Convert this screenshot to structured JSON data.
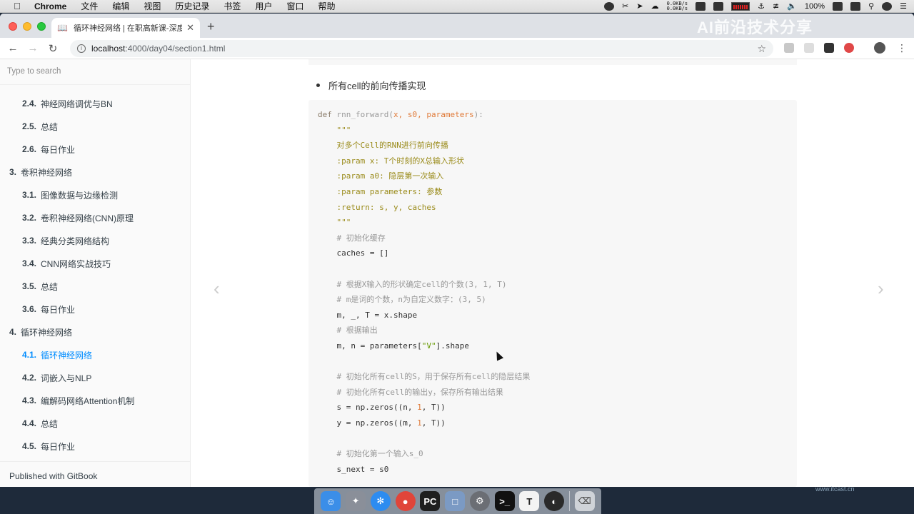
{
  "menubar": {
    "app": "Chrome",
    "items": [
      "文件",
      "编辑",
      "视图",
      "历史记录",
      "书签",
      "用户",
      "窗口",
      "帮助"
    ],
    "netspeed_up": "0.0KB/s",
    "netspeed_down": "0.0KB/s",
    "battery": "100%"
  },
  "browser": {
    "tab_title": "循环神经网络 | 在职高新课-深度",
    "watermark": "AI前沿技术分享",
    "url_host": "localhost",
    "url_path": ":4000/day04/section1.html"
  },
  "sidebar": {
    "search_placeholder": "Type to search",
    "items": [
      {
        "num": "2.4.",
        "label": "神经网络调优与BN",
        "level": 2
      },
      {
        "num": "2.5.",
        "label": "总结",
        "level": 2
      },
      {
        "num": "2.6.",
        "label": "每日作业",
        "level": 2
      },
      {
        "num": "3.",
        "label": "卷积神经网络",
        "level": 1
      },
      {
        "num": "3.1.",
        "label": "图像数据与边缘检测",
        "level": 2
      },
      {
        "num": "3.2.",
        "label": "卷积神经网络(CNN)原理",
        "level": 2
      },
      {
        "num": "3.3.",
        "label": "经典分类网络结构",
        "level": 2
      },
      {
        "num": "3.4.",
        "label": "CNN网络实战技巧",
        "level": 2
      },
      {
        "num": "3.5.",
        "label": "总结",
        "level": 2
      },
      {
        "num": "3.6.",
        "label": "每日作业",
        "level": 2
      },
      {
        "num": "4.",
        "label": "循环神经网络",
        "level": 1
      },
      {
        "num": "4.1.",
        "label": "循环神经网络",
        "level": 2,
        "active": true
      },
      {
        "num": "4.2.",
        "label": "词嵌入与NLP",
        "level": 2
      },
      {
        "num": "4.3.",
        "label": "编解码网络Attention机制",
        "level": 2
      },
      {
        "num": "4.4.",
        "label": "总结",
        "level": 2
      },
      {
        "num": "4.5.",
        "label": "每日作业",
        "level": 2
      }
    ],
    "footer": "Published with GitBook"
  },
  "content": {
    "bullet": "所有cell的前向传播实现",
    "code_lines": [
      [
        [
          "kw",
          "def "
        ],
        [
          "fn",
          "rnn_forward("
        ],
        [
          "pm",
          "x, s0, parameters"
        ],
        [
          "fn",
          "):"
        ]
      ],
      [
        [
          "",
          "    "
        ],
        [
          "ds",
          "\"\"\""
        ]
      ],
      [
        [
          "",
          "    "
        ],
        [
          "ds",
          "对多个Cell的RNN进行前向传播"
        ]
      ],
      [
        [
          "",
          "    "
        ],
        [
          "ds",
          ":param x: T个时刻的X总输入形状"
        ]
      ],
      [
        [
          "",
          "    "
        ],
        [
          "ds",
          ":param a0: 隐层第一次输入"
        ]
      ],
      [
        [
          "",
          "    "
        ],
        [
          "ds",
          ":param parameters: 参数"
        ]
      ],
      [
        [
          "",
          "    "
        ],
        [
          "ds",
          ":return: s, y, caches"
        ]
      ],
      [
        [
          "",
          "    "
        ],
        [
          "ds",
          "\"\"\""
        ]
      ],
      [
        [
          "",
          "    "
        ],
        [
          "cm",
          "# 初始化缓存"
        ]
      ],
      [
        [
          "",
          "    caches = []"
        ]
      ],
      [
        [
          "",
          ""
        ]
      ],
      [
        [
          "",
          "    "
        ],
        [
          "cm",
          "# 根据X输入的形状确定cell的个数(3, 1, T)"
        ]
      ],
      [
        [
          "",
          "    "
        ],
        [
          "cm",
          "# m是词的个数，n为自定义数字：(3, 5)"
        ]
      ],
      [
        [
          "",
          "    m, _, T = x.shape"
        ]
      ],
      [
        [
          "",
          "    "
        ],
        [
          "cm",
          "# 根据输出"
        ]
      ],
      [
        [
          "",
          "    m, n = parameters["
        ],
        [
          "st",
          "\"V\""
        ],
        [
          "",
          "].shape"
        ]
      ],
      [
        [
          "",
          ""
        ]
      ],
      [
        [
          "",
          "    "
        ],
        [
          "cm",
          "# 初始化所有cell的S，用于保存所有cell的隐层结果"
        ]
      ],
      [
        [
          "",
          "    "
        ],
        [
          "cm",
          "# 初始化所有cell的输出y，保存所有输出结果"
        ]
      ],
      [
        [
          "",
          "    s = np.zeros((n, "
        ],
        [
          "nm",
          "1"
        ],
        [
          "",
          ", T))"
        ]
      ],
      [
        [
          "",
          "    y = np.zeros((m, "
        ],
        [
          "nm",
          "1"
        ],
        [
          "",
          ", T))"
        ]
      ],
      [
        [
          "",
          ""
        ]
      ],
      [
        [
          "",
          "    "
        ],
        [
          "cm",
          "# 初始化第一个输入s_0"
        ]
      ],
      [
        [
          "",
          "    s_next = s0"
        ]
      ]
    ],
    "prev_arrow": "‹",
    "next_arrow": "›"
  },
  "footer_watermark": "www.itcast.cn"
}
